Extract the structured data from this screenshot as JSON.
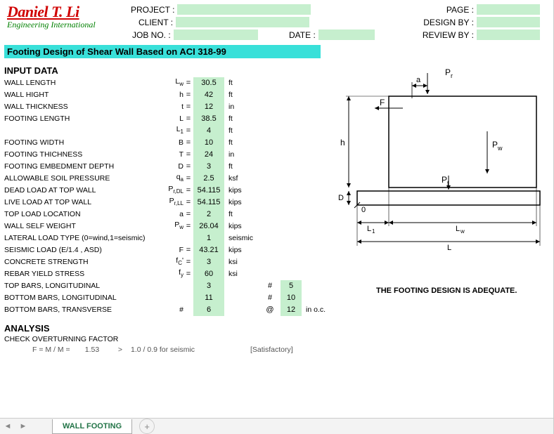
{
  "header": {
    "logo_name": "Daniel T. Li",
    "logo_sub": "Engineering International",
    "project_lbl": "PROJECT :",
    "client_lbl": "CLIENT :",
    "jobno_lbl": "JOB NO. :",
    "date_lbl": "DATE :",
    "page_lbl": "PAGE :",
    "design_lbl": "DESIGN BY :",
    "review_lbl": "REVIEW BY :"
  },
  "section_title": "Footing Design of Shear Wall Based on ACI 318-99",
  "input_title": "INPUT DATA",
  "rows": [
    {
      "desc": "WALL LENGTH",
      "sym": "L<sub>w</sub>",
      "val": "30.5",
      "unit": "ft"
    },
    {
      "desc": "WALL HIGHT",
      "sym": "h",
      "val": "42",
      "unit": "ft"
    },
    {
      "desc": "WALL THICKNESS",
      "sym": "t",
      "val": "12",
      "unit": "in"
    },
    {
      "desc": "FOOTING LENGTH",
      "sym": "L",
      "val": "38.5",
      "unit": "ft"
    },
    {
      "desc": "",
      "sym": "L<sub>1</sub>",
      "val": "4",
      "unit": "ft"
    },
    {
      "desc": "FOOTING WIDTH",
      "sym": "B",
      "val": "10",
      "unit": "ft"
    },
    {
      "desc": "FOOTING THICHNESS",
      "sym": "T",
      "val": "24",
      "unit": "in"
    },
    {
      "desc": "FOOTING EMBEDMENT DEPTH",
      "sym": "D",
      "val": "3",
      "unit": "ft"
    },
    {
      "desc": "ALLOWABLE SOIL PRESSURE",
      "sym": "q<sub>a</sub>",
      "val": "2.5",
      "unit": "ksf"
    },
    {
      "desc": "DEAD LOAD AT TOP WALL",
      "sym": "P<sub>r,DL</sub>",
      "val": "54.115",
      "unit": "kips"
    },
    {
      "desc": "LIVE LOAD AT TOP WALL",
      "sym": "P<sub>r,LL</sub>",
      "val": "54.115",
      "unit": "kips"
    },
    {
      "desc": "TOP LOAD LOCATION",
      "sym": "a",
      "val": "2",
      "unit": "ft"
    },
    {
      "desc": "WALL SELF WEIGHT",
      "sym": "P<sub>w</sub>",
      "val": "26.04",
      "unit": "kips"
    },
    {
      "desc": "LATERAL LOAD TYPE (0=wind,1=seismic)",
      "sym": "",
      "val": "1",
      "unit": "seismic"
    },
    {
      "desc": "SEISMIC LOAD (E/1.4 , ASD)",
      "sym": "F",
      "val": "43.21",
      "unit": "kips"
    },
    {
      "desc": "CONCRETE STRENGTH",
      "sym": "f<sub>C</sub>'",
      "val": "3",
      "unit": "ksi"
    },
    {
      "desc": "REBAR YIELD STRESS",
      "sym": "f<sub>y</sub>",
      "val": "60",
      "unit": "ksi"
    },
    {
      "desc": "TOP BARS, LONGITUDINAL",
      "sym": "",
      "val": "3",
      "unit": "",
      "sharp": "#",
      "extra": "5"
    },
    {
      "desc": "BOTTOM BARS, LONGITUDINAL",
      "sym": "",
      "val": "11",
      "unit": "",
      "sharp": "#",
      "extra": "10"
    },
    {
      "desc": "BOTTOM BARS, TRANSVERSE",
      "sym": "#",
      "val": "6",
      "unit": "",
      "sharp": "@",
      "extra": "12",
      "extra_unit": "in o.c."
    }
  ],
  "analysis_title": "ANALYSIS",
  "analysis": {
    "line1": "CHECK OVERTURNING FACTOR",
    "line2_a": "F = M / M =",
    "line2_b": "1.53",
    "line2_c": ">",
    "line2_d": "1.0 / 0.9   for seismic",
    "line2_e": "[Satisfactory]"
  },
  "adequate": "THE FOOTING DESIGN IS ADEQUATE.",
  "tab": "WALL FOOTING",
  "diagram_labels": {
    "Pr": "P",
    "Pr_sub": "r",
    "a": "a",
    "F": "F",
    "Pw": "P",
    "Pw_sub": "w",
    "h": "h",
    "Pf": "P",
    "Pf_sub": "f",
    "D": "D",
    "zero": "0",
    "L1": "L",
    "L1_sub": "1",
    "Lw": "L",
    "Lw_sub": "w",
    "L": "L"
  }
}
